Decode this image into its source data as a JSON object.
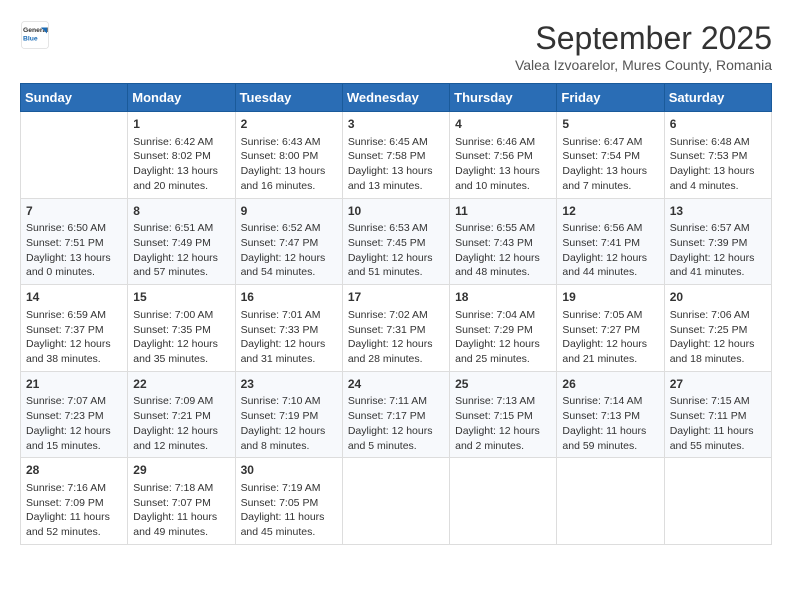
{
  "logo": {
    "general": "General",
    "blue": "Blue"
  },
  "header": {
    "month": "September 2025",
    "location": "Valea Izvoarelor, Mures County, Romania"
  },
  "weekdays": [
    "Sunday",
    "Monday",
    "Tuesday",
    "Wednesday",
    "Thursday",
    "Friday",
    "Saturday"
  ],
  "weeks": [
    [
      {
        "day": "",
        "data": ""
      },
      {
        "day": "1",
        "data": "Sunrise: 6:42 AM\nSunset: 8:02 PM\nDaylight: 13 hours and 20 minutes."
      },
      {
        "day": "2",
        "data": "Sunrise: 6:43 AM\nSunset: 8:00 PM\nDaylight: 13 hours and 16 minutes."
      },
      {
        "day": "3",
        "data": "Sunrise: 6:45 AM\nSunset: 7:58 PM\nDaylight: 13 hours and 13 minutes."
      },
      {
        "day": "4",
        "data": "Sunrise: 6:46 AM\nSunset: 7:56 PM\nDaylight: 13 hours and 10 minutes."
      },
      {
        "day": "5",
        "data": "Sunrise: 6:47 AM\nSunset: 7:54 PM\nDaylight: 13 hours and 7 minutes."
      },
      {
        "day": "6",
        "data": "Sunrise: 6:48 AM\nSunset: 7:53 PM\nDaylight: 13 hours and 4 minutes."
      }
    ],
    [
      {
        "day": "7",
        "data": "Sunrise: 6:50 AM\nSunset: 7:51 PM\nDaylight: 13 hours and 0 minutes."
      },
      {
        "day": "8",
        "data": "Sunrise: 6:51 AM\nSunset: 7:49 PM\nDaylight: 12 hours and 57 minutes."
      },
      {
        "day": "9",
        "data": "Sunrise: 6:52 AM\nSunset: 7:47 PM\nDaylight: 12 hours and 54 minutes."
      },
      {
        "day": "10",
        "data": "Sunrise: 6:53 AM\nSunset: 7:45 PM\nDaylight: 12 hours and 51 minutes."
      },
      {
        "day": "11",
        "data": "Sunrise: 6:55 AM\nSunset: 7:43 PM\nDaylight: 12 hours and 48 minutes."
      },
      {
        "day": "12",
        "data": "Sunrise: 6:56 AM\nSunset: 7:41 PM\nDaylight: 12 hours and 44 minutes."
      },
      {
        "day": "13",
        "data": "Sunrise: 6:57 AM\nSunset: 7:39 PM\nDaylight: 12 hours and 41 minutes."
      }
    ],
    [
      {
        "day": "14",
        "data": "Sunrise: 6:59 AM\nSunset: 7:37 PM\nDaylight: 12 hours and 38 minutes."
      },
      {
        "day": "15",
        "data": "Sunrise: 7:00 AM\nSunset: 7:35 PM\nDaylight: 12 hours and 35 minutes."
      },
      {
        "day": "16",
        "data": "Sunrise: 7:01 AM\nSunset: 7:33 PM\nDaylight: 12 hours and 31 minutes."
      },
      {
        "day": "17",
        "data": "Sunrise: 7:02 AM\nSunset: 7:31 PM\nDaylight: 12 hours and 28 minutes."
      },
      {
        "day": "18",
        "data": "Sunrise: 7:04 AM\nSunset: 7:29 PM\nDaylight: 12 hours and 25 minutes."
      },
      {
        "day": "19",
        "data": "Sunrise: 7:05 AM\nSunset: 7:27 PM\nDaylight: 12 hours and 21 minutes."
      },
      {
        "day": "20",
        "data": "Sunrise: 7:06 AM\nSunset: 7:25 PM\nDaylight: 12 hours and 18 minutes."
      }
    ],
    [
      {
        "day": "21",
        "data": "Sunrise: 7:07 AM\nSunset: 7:23 PM\nDaylight: 12 hours and 15 minutes."
      },
      {
        "day": "22",
        "data": "Sunrise: 7:09 AM\nSunset: 7:21 PM\nDaylight: 12 hours and 12 minutes."
      },
      {
        "day": "23",
        "data": "Sunrise: 7:10 AM\nSunset: 7:19 PM\nDaylight: 12 hours and 8 minutes."
      },
      {
        "day": "24",
        "data": "Sunrise: 7:11 AM\nSunset: 7:17 PM\nDaylight: 12 hours and 5 minutes."
      },
      {
        "day": "25",
        "data": "Sunrise: 7:13 AM\nSunset: 7:15 PM\nDaylight: 12 hours and 2 minutes."
      },
      {
        "day": "26",
        "data": "Sunrise: 7:14 AM\nSunset: 7:13 PM\nDaylight: 11 hours and 59 minutes."
      },
      {
        "day": "27",
        "data": "Sunrise: 7:15 AM\nSunset: 7:11 PM\nDaylight: 11 hours and 55 minutes."
      }
    ],
    [
      {
        "day": "28",
        "data": "Sunrise: 7:16 AM\nSunset: 7:09 PM\nDaylight: 11 hours and 52 minutes."
      },
      {
        "day": "29",
        "data": "Sunrise: 7:18 AM\nSunset: 7:07 PM\nDaylight: 11 hours and 49 minutes."
      },
      {
        "day": "30",
        "data": "Sunrise: 7:19 AM\nSunset: 7:05 PM\nDaylight: 11 hours and 45 minutes."
      },
      {
        "day": "",
        "data": ""
      },
      {
        "day": "",
        "data": ""
      },
      {
        "day": "",
        "data": ""
      },
      {
        "day": "",
        "data": ""
      }
    ]
  ]
}
